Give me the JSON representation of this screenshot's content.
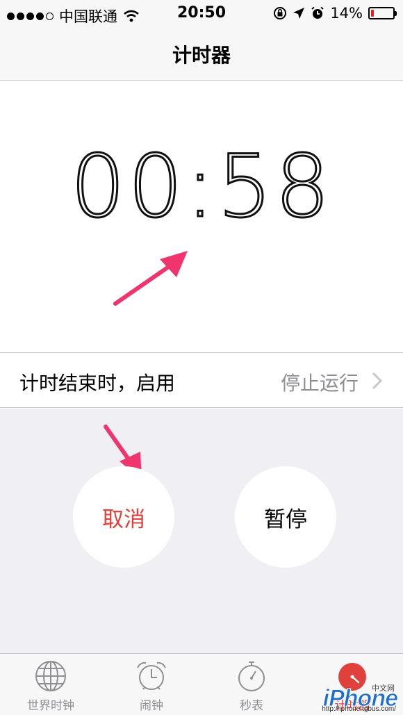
{
  "status_bar": {
    "carrier": "中国联通",
    "time": "20:50",
    "battery_percent": "14%",
    "battery_level": 0.14,
    "battery_color": "#e02020",
    "icons": [
      "signal-dots",
      "wifi-icon",
      "rotation-lock-icon",
      "location-icon",
      "alarm-icon",
      "battery-icon"
    ]
  },
  "nav": {
    "title": "计时器"
  },
  "timer": {
    "minutes": "00",
    "separator": ":",
    "seconds": "58"
  },
  "setting": {
    "label": "计时结束时，启用",
    "value": "停止运行"
  },
  "controls": {
    "cancel_label": "取消",
    "pause_label": "暂停"
  },
  "tabs": [
    {
      "label": "世界时钟",
      "icon": "globe-icon"
    },
    {
      "label": "闹钟",
      "icon": "alarm-clock-icon"
    },
    {
      "label": "秒表",
      "icon": "stopwatch-icon"
    },
    {
      "label": "计时器",
      "icon": "timer-icon",
      "active": true
    }
  ],
  "watermark": {
    "brand": "iPhone",
    "url": "http://iphone.tgbus.com/",
    "cn": "中文网"
  },
  "colors": {
    "accent": "#e0413b",
    "arrow": "#f0346e",
    "background": "#efeff4"
  }
}
